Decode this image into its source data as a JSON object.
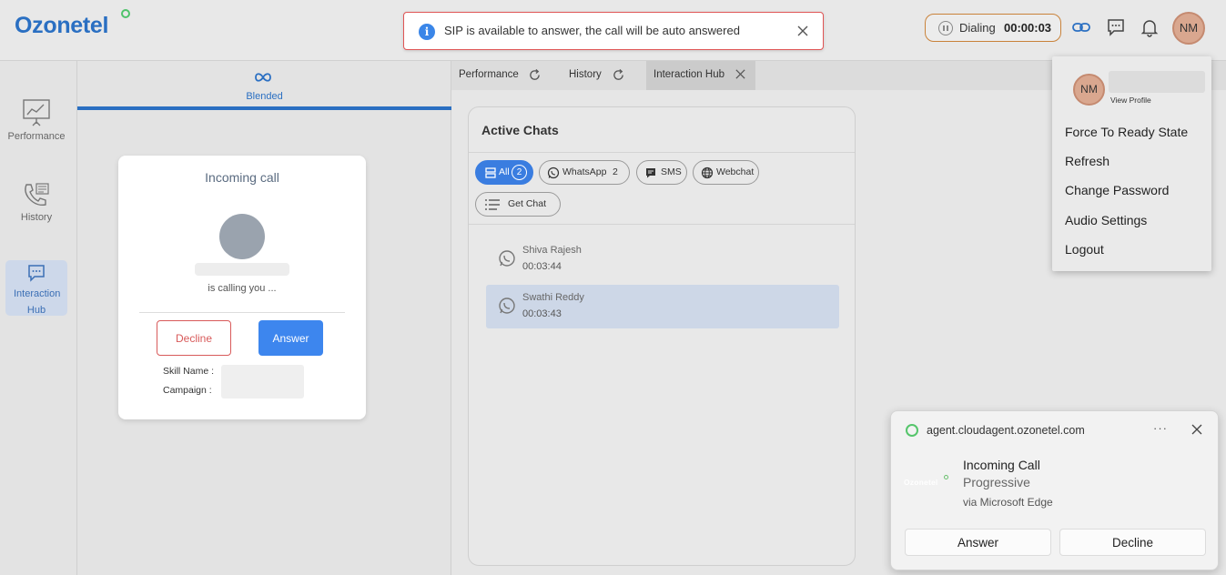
{
  "app": {
    "logo": "Ozonetel"
  },
  "toast": {
    "message": "SIP is available to answer, the call will be auto answered"
  },
  "dialing": {
    "label": "Dialing",
    "timer": "00:00:03"
  },
  "user": {
    "initials": "NM"
  },
  "leftnav": {
    "items": [
      {
        "label": "Performance"
      },
      {
        "label": "History"
      },
      {
        "label": "Interaction Hub"
      }
    ]
  },
  "blended": {
    "tab_label": "Blended"
  },
  "call_dialog": {
    "title": "Incoming call",
    "calling_text": "is calling you ...",
    "decline_label": "Decline",
    "answer_label": "Answer",
    "skill_label": "Skill Name :",
    "campaign_label": "Campaign :"
  },
  "tabs": [
    {
      "label": "Performance"
    },
    {
      "label": "History"
    },
    {
      "label": "Interaction Hub"
    }
  ],
  "active_chats": {
    "title": "Active Chats",
    "filters": [
      {
        "label": "All",
        "count": "2"
      },
      {
        "label": "WhatsApp",
        "count": "2"
      },
      {
        "label": "SMS"
      },
      {
        "label": "Webchat"
      },
      {
        "label": "Get Chat"
      }
    ],
    "items": [
      {
        "name": "Shiva Rajesh",
        "time": "00:03:44"
      },
      {
        "name": "Swathi Reddy",
        "time": "00:03:43"
      }
    ]
  },
  "profile_menu": {
    "initials": "NM",
    "view_profile": "View Profile",
    "items": [
      "Force To Ready State",
      "Refresh",
      "Change Password",
      "Audio Settings",
      "Logout"
    ]
  },
  "notification": {
    "source": "agent.cloudagent.ozonetel.com",
    "brand": "Ozonetel",
    "title": "Incoming Call",
    "subtitle": "Progressive",
    "via": "via Microsoft Edge",
    "answer_label": "Answer",
    "decline_label": "Decline"
  },
  "colors": {
    "brand_blue": "#2a6fc2",
    "accent_green": "#4fc36b",
    "decline_red": "#d85a5a",
    "answer_blue": "#3d86ee"
  }
}
